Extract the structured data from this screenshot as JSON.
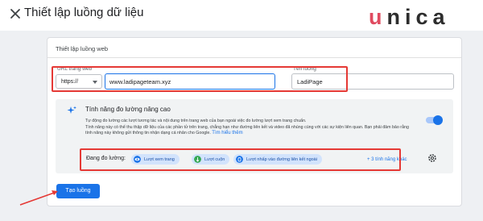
{
  "header": {
    "title": "Thiết lập luồng dữ liệu",
    "logo_text": "unica"
  },
  "card": {
    "title": "Thiết lập luồng web",
    "url_label": "URL trang web",
    "protocol_value": "https://",
    "url_value": "www.ladipageteam.xyz",
    "stream_label": "Tên luồng",
    "stream_value": "LadiPage"
  },
  "enhanced": {
    "title": "Tính năng đo lường nâng cao",
    "desc_line1": "Tự động đo lường các lượt tương tác và nội dung trên trang web của bạn ngoài việc đo lường lượt xem trang chuẩn.",
    "desc_line2": "Tính năng này có thể thu thập dữ liệu của các phần tử trên trang, chẳng hạn như đường liên kết và video đã nhúng cùng với các sự kiện liên quan. Bạn phải đảm bảo rằng tính năng này không gửi thông tin nhận dạng cá nhân cho Google.",
    "learn_more": "Tìm hiểu thêm",
    "toggle_on": true,
    "measuring_label": "Đang đo lường:",
    "chips": [
      "Lượt xem trang",
      "Lượt cuộn",
      "Lượt nhấp vào đường liên kết ngoài"
    ],
    "more_link": "+ 3 tính năng khác"
  },
  "actions": {
    "create_label": "Tạo luồng"
  },
  "colors": {
    "accent": "#1a73e8",
    "annotation_red": "#e53935",
    "logo_pink": "#e04a5f"
  },
  "icons": {
    "close": "close-icon",
    "sparkle": "sparkle-icon",
    "settings": "gear-icon",
    "pageview": "eye-icon",
    "scroll": "scroll-icon",
    "outbound": "link-click-icon"
  }
}
